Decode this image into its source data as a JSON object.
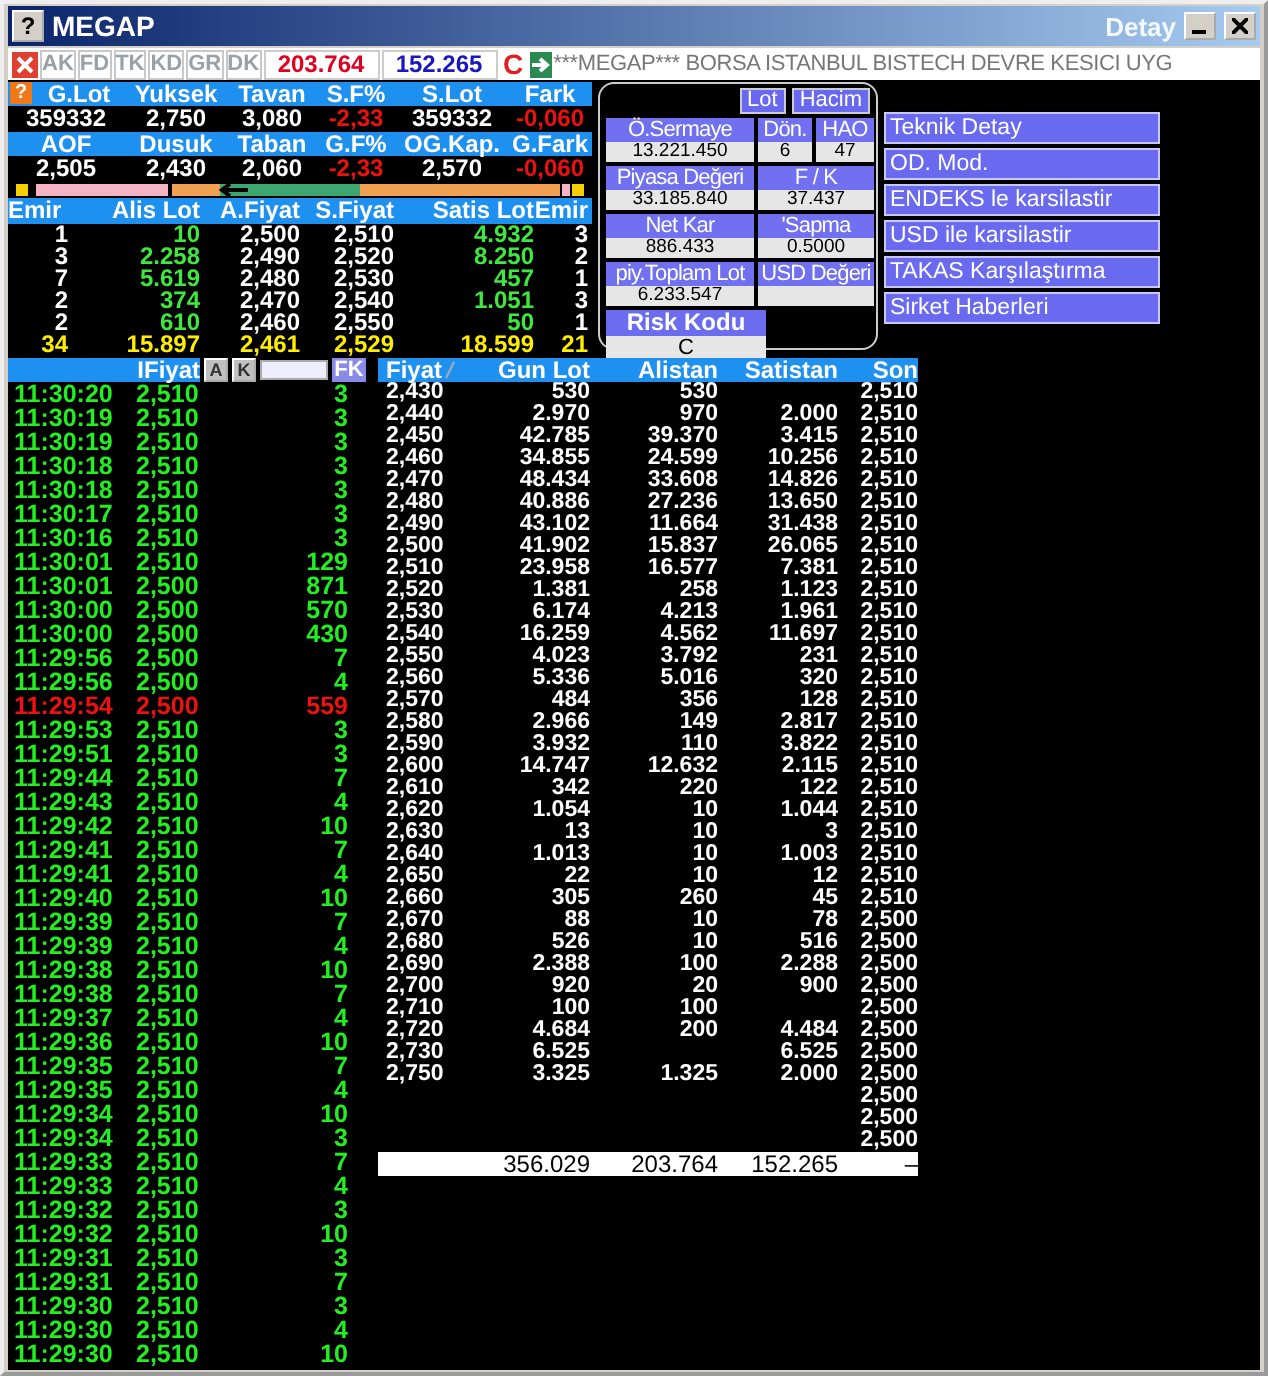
{
  "window": {
    "icon": "?",
    "title": "MEGAP",
    "subtitle": "Detay"
  },
  "toolbar": {
    "tabs": [
      "AK",
      "FD",
      "TK",
      "KD",
      "GR",
      "DK"
    ],
    "buy_total": "203.764",
    "sell_total": "152.265",
    "risk": "C",
    "ticker": "***MEGAP*** BORSA ISTANBUL BISTECH DEVRE KESICI UYG"
  },
  "summary": {
    "help": "?",
    "rows": [
      {
        "labels": [
          "G.Lot",
          "Yuksek",
          "Tavan",
          "S.F%",
          "S.Lot",
          "Fark"
        ],
        "values": [
          {
            "text": "359332",
            "negative": false
          },
          {
            "text": "2,750",
            "negative": false
          },
          {
            "text": "3,080",
            "negative": false
          },
          {
            "text": "-2,33",
            "negative": true
          },
          {
            "text": "359332",
            "negative": false
          },
          {
            "text": "-0,060",
            "negative": true
          }
        ]
      },
      {
        "labels": [
          "AOF",
          "Dusuk",
          "Taban",
          "G.F%",
          "OG.Kap.",
          "G.Fark"
        ],
        "values": [
          {
            "text": "2,505",
            "negative": false
          },
          {
            "text": "2,430",
            "negative": false
          },
          {
            "text": "2,060",
            "negative": false
          },
          {
            "text": "-2,33",
            "negative": true
          },
          {
            "text": "2,570",
            "negative": false
          },
          {
            "text": "-0,060",
            "negative": true
          }
        ]
      }
    ]
  },
  "order_book": {
    "columns": [
      "Emir",
      "Alis Lot",
      "A.Fiyat",
      "S.Fiyat",
      "Satis Lot",
      "Emir"
    ],
    "rows": [
      [
        "1",
        "10",
        "2,500",
        "2,510",
        "4.932",
        "3"
      ],
      [
        "3",
        "2.258",
        "2,490",
        "2,520",
        "8.250",
        "2"
      ],
      [
        "7",
        "5.619",
        "2,480",
        "2,530",
        "457",
        "1"
      ],
      [
        "2",
        "374",
        "2,470",
        "2,540",
        "1.051",
        "3"
      ],
      [
        "2",
        "610",
        "2,460",
        "2,550",
        "50",
        "1"
      ]
    ],
    "total": [
      "34",
      "15.897",
      "2,461",
      "2,529",
      "18.599",
      "21"
    ]
  },
  "detail_panel": {
    "toggles": [
      "Lot",
      "Hacim"
    ],
    "rows": [
      [
        {
          "label": "Ö.Sermaye",
          "value": "13.221.450"
        },
        {
          "label": "Dön.",
          "value": "6"
        },
        {
          "label": "HAO",
          "value": "47"
        }
      ],
      [
        {
          "label": "Piyasa Değeri",
          "value": "33.185.840"
        },
        {
          "label": "F / K",
          "value": "37.437"
        }
      ],
      [
        {
          "label": "Net Kar",
          "value": "886.433"
        },
        {
          "label": "'Sapma",
          "value": "0.5000"
        }
      ],
      [
        {
          "label": "piy.Toplam Lot",
          "value": "6.233.547"
        },
        {
          "label": "USD Değeri"
        }
      ]
    ],
    "risk": {
      "label": "Risk Kodu",
      "value": "C"
    }
  },
  "actions": [
    "Teknik Detay",
    "OD. Mod.",
    "ENDEKS le karsilastir",
    "USD ile karsilastir",
    "TAKAS Karşılaştırma",
    "Sirket Haberleri"
  ],
  "trades": {
    "header": "IFiyat",
    "buttons": [
      "A",
      "K"
    ],
    "filter_button": "FK",
    "rows": [
      {
        "time": "11:30:20",
        "price": "2,510",
        "lot": "3",
        "kind": "up"
      },
      {
        "time": "11:30:19",
        "price": "2,510",
        "lot": "3",
        "kind": "up"
      },
      {
        "time": "11:30:19",
        "price": "2,510",
        "lot": "3",
        "kind": "up"
      },
      {
        "time": "11:30:18",
        "price": "2,510",
        "lot": "3",
        "kind": "up"
      },
      {
        "time": "11:30:18",
        "price": "2,510",
        "lot": "3",
        "kind": "up"
      },
      {
        "time": "11:30:17",
        "price": "2,510",
        "lot": "3",
        "kind": "up"
      },
      {
        "time": "11:30:16",
        "price": "2,510",
        "lot": "3",
        "kind": "up"
      },
      {
        "time": "11:30:01",
        "price": "2,510",
        "lot": "129",
        "kind": "up"
      },
      {
        "time": "11:30:01",
        "price": "2,500",
        "lot": "871",
        "kind": "up"
      },
      {
        "time": "11:30:00",
        "price": "2,500",
        "lot": "570",
        "kind": "up"
      },
      {
        "time": "11:30:00",
        "price": "2,500",
        "lot": "430",
        "kind": "up"
      },
      {
        "time": "11:29:56",
        "price": "2,500",
        "lot": "7",
        "kind": "up"
      },
      {
        "time": "11:29:56",
        "price": "2,500",
        "lot": "4",
        "kind": "up"
      },
      {
        "time": "11:29:54",
        "price": "2,500",
        "lot": "559",
        "kind": "down"
      },
      {
        "time": "11:29:53",
        "price": "2,510",
        "lot": "3",
        "kind": "up"
      },
      {
        "time": "11:29:51",
        "price": "2,510",
        "lot": "3",
        "kind": "up"
      },
      {
        "time": "11:29:44",
        "price": "2,510",
        "lot": "7",
        "kind": "up"
      },
      {
        "time": "11:29:43",
        "price": "2,510",
        "lot": "4",
        "kind": "up"
      },
      {
        "time": "11:29:42",
        "price": "2,510",
        "lot": "10",
        "kind": "up"
      },
      {
        "time": "11:29:41",
        "price": "2,510",
        "lot": "7",
        "kind": "up"
      },
      {
        "time": "11:29:41",
        "price": "2,510",
        "lot": "4",
        "kind": "up"
      },
      {
        "time": "11:29:40",
        "price": "2,510",
        "lot": "10",
        "kind": "up"
      },
      {
        "time": "11:29:39",
        "price": "2,510",
        "lot": "7",
        "kind": "up"
      },
      {
        "time": "11:29:39",
        "price": "2,510",
        "lot": "4",
        "kind": "up"
      },
      {
        "time": "11:29:38",
        "price": "2,510",
        "lot": "10",
        "kind": "up"
      },
      {
        "time": "11:29:38",
        "price": "2,510",
        "lot": "7",
        "kind": "up"
      },
      {
        "time": "11:29:37",
        "price": "2,510",
        "lot": "4",
        "kind": "up"
      },
      {
        "time": "11:29:36",
        "price": "2,510",
        "lot": "10",
        "kind": "up"
      },
      {
        "time": "11:29:35",
        "price": "2,510",
        "lot": "7",
        "kind": "up"
      },
      {
        "time": "11:29:35",
        "price": "2,510",
        "lot": "4",
        "kind": "up"
      },
      {
        "time": "11:29:34",
        "price": "2,510",
        "lot": "10",
        "kind": "up"
      },
      {
        "time": "11:29:34",
        "price": "2,510",
        "lot": "3",
        "kind": "up"
      },
      {
        "time": "11:29:33",
        "price": "2,510",
        "lot": "7",
        "kind": "up"
      },
      {
        "time": "11:29:33",
        "price": "2,510",
        "lot": "4",
        "kind": "up"
      },
      {
        "time": "11:29:32",
        "price": "2,510",
        "lot": "3",
        "kind": "up"
      },
      {
        "time": "11:29:32",
        "price": "2,510",
        "lot": "10",
        "kind": "up"
      },
      {
        "time": "11:29:31",
        "price": "2,510",
        "lot": "3",
        "kind": "up"
      },
      {
        "time": "11:29:31",
        "price": "2,510",
        "lot": "7",
        "kind": "up"
      },
      {
        "time": "11:29:30",
        "price": "2,510",
        "lot": "3",
        "kind": "up"
      },
      {
        "time": "11:29:30",
        "price": "2,510",
        "lot": "4",
        "kind": "up"
      },
      {
        "time": "11:29:30",
        "price": "2,510",
        "lot": "10",
        "kind": "up"
      }
    ]
  },
  "price_table": {
    "columns": [
      "Fiyat",
      "Gun Lot",
      "Alistan",
      "Satistan",
      "Son"
    ],
    "rows": [
      {
        "fiyat": "2,430",
        "gun_lot": "530",
        "alistan": "530",
        "son": "2,510"
      },
      {
        "fiyat": "2,440",
        "gun_lot": "2.970",
        "alistan": "970",
        "satistan": "2.000",
        "son": "2,510"
      },
      {
        "fiyat": "2,450",
        "gun_lot": "42.785",
        "alistan": "39.370",
        "satistan": "3.415",
        "son": "2,510"
      },
      {
        "fiyat": "2,460",
        "gun_lot": "34.855",
        "alistan": "24.599",
        "satistan": "10.256",
        "son": "2,510"
      },
      {
        "fiyat": "2,470",
        "gun_lot": "48.434",
        "alistan": "33.608",
        "satistan": "14.826",
        "son": "2,510"
      },
      {
        "fiyat": "2,480",
        "gun_lot": "40.886",
        "alistan": "27.236",
        "satistan": "13.650",
        "son": "2,510"
      },
      {
        "fiyat": "2,490",
        "gun_lot": "43.102",
        "alistan": "11.664",
        "satistan": "31.438",
        "son": "2,510"
      },
      {
        "fiyat": "2,500",
        "gun_lot": "41.902",
        "alistan": "15.837",
        "satistan": "26.065",
        "son": "2,510"
      },
      {
        "fiyat": "2,510",
        "gun_lot": "23.958",
        "alistan": "16.577",
        "satistan": "7.381",
        "son": "2,510"
      },
      {
        "fiyat": "2,520",
        "gun_lot": "1.381",
        "alistan": "258",
        "satistan": "1.123",
        "son": "2,510"
      },
      {
        "fiyat": "2,530",
        "gun_lot": "6.174",
        "alistan": "4.213",
        "satistan": "1.961",
        "son": "2,510"
      },
      {
        "fiyat": "2,540",
        "gun_lot": "16.259",
        "alistan": "4.562",
        "satistan": "11.697",
        "son": "2,510"
      },
      {
        "fiyat": "2,550",
        "gun_lot": "4.023",
        "alistan": "3.792",
        "satistan": "231",
        "son": "2,510"
      },
      {
        "fiyat": "2,560",
        "gun_lot": "5.336",
        "alistan": "5.016",
        "satistan": "320",
        "son": "2,510"
      },
      {
        "fiyat": "2,570",
        "gun_lot": "484",
        "alistan": "356",
        "satistan": "128",
        "son": "2,510"
      },
      {
        "fiyat": "2,580",
        "gun_lot": "2.966",
        "alistan": "149",
        "satistan": "2.817",
        "son": "2,510"
      },
      {
        "fiyat": "2,590",
        "gun_lot": "3.932",
        "alistan": "110",
        "satistan": "3.822",
        "son": "2,510"
      },
      {
        "fiyat": "2,600",
        "gun_lot": "14.747",
        "alistan": "12.632",
        "satistan": "2.115",
        "son": "2,510"
      },
      {
        "fiyat": "2,610",
        "gun_lot": "342",
        "alistan": "220",
        "satistan": "122",
        "son": "2,510"
      },
      {
        "fiyat": "2,620",
        "gun_lot": "1.054",
        "alistan": "10",
        "satistan": "1.044",
        "son": "2,510"
      },
      {
        "fiyat": "2,630",
        "gun_lot": "13",
        "alistan": "10",
        "satistan": "3",
        "son": "2,510"
      },
      {
        "fiyat": "2,640",
        "gun_lot": "1.013",
        "alistan": "10",
        "satistan": "1.003",
        "son": "2,510"
      },
      {
        "fiyat": "2,650",
        "gun_lot": "22",
        "alistan": "10",
        "satistan": "12",
        "son": "2,510"
      },
      {
        "fiyat": "2,660",
        "gun_lot": "305",
        "alistan": "260",
        "satistan": "45",
        "son": "2,510"
      },
      {
        "fiyat": "2,670",
        "gun_lot": "88",
        "alistan": "10",
        "satistan": "78",
        "son": "2,500"
      },
      {
        "fiyat": "2,680",
        "gun_lot": "526",
        "alistan": "10",
        "satistan": "516",
        "son": "2,500"
      },
      {
        "fiyat": "2,690",
        "gun_lot": "2.388",
        "alistan": "100",
        "satistan": "2.288",
        "son": "2,500"
      },
      {
        "fiyat": "2,700",
        "gun_lot": "920",
        "alistan": "20",
        "satistan": "900",
        "son": "2,500"
      },
      {
        "fiyat": "2,710",
        "gun_lot": "100",
        "alistan": "100",
        "son": "2,500"
      },
      {
        "fiyat": "2,720",
        "gun_lot": "4.684",
        "alistan": "200",
        "satistan": "4.484",
        "son": "2,500"
      },
      {
        "fiyat": "2,730",
        "gun_lot": "6.525",
        "satistan": "6.525",
        "son": "2,500"
      },
      {
        "fiyat": "2,750",
        "gun_lot": "3.325",
        "alistan": "1.325",
        "satistan": "2.000",
        "son": "2,500"
      },
      {
        "son": "2,500"
      },
      {
        "son": "2,500"
      },
      {
        "son": "2,500"
      }
    ],
    "totals": {
      "gun_lot": "356.029",
      "alistan": "203.764",
      "satistan": "152.265",
      "son": "–"
    }
  }
}
